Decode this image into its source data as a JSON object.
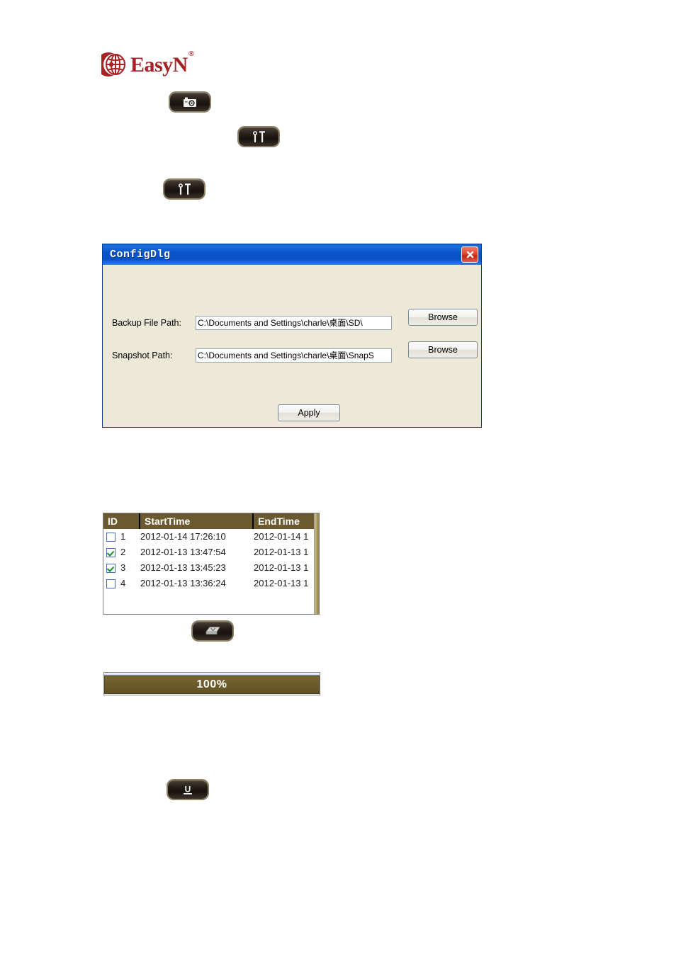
{
  "page": {
    "background": "#ffffff",
    "brand_color": "#a52225"
  },
  "logo": {
    "word": "EasyN",
    "registered_mark": "®",
    "icon": "globe-icon"
  },
  "toolbar_buttons": [
    {
      "name": "snapshot-button",
      "icon": "camera-icon",
      "label": ""
    },
    {
      "name": "tools-button-1",
      "icon": "tools-icon",
      "label": ""
    },
    {
      "name": "tools-button-2",
      "icon": "tools-icon",
      "label": ""
    },
    {
      "name": "backup-button",
      "icon": "floppy-disk-icon",
      "label": ""
    },
    {
      "name": "update-button",
      "icon": "letter-u-icon",
      "label": "U"
    }
  ],
  "dialog": {
    "title": "ConfigDlg",
    "close_icon": "close-icon",
    "titlebar_color": "#0b51c6",
    "body_color": "#ece9d8",
    "fields": [
      {
        "label": "Backup File Path:",
        "value": "C:\\Documents and Settings\\charle\\桌面\\SD\\",
        "placeholder": "",
        "browse_label": "Browse"
      },
      {
        "label": "Snapshot Path:",
        "value": "C:\\Documents and Settings\\charle\\桌面\\SnapS",
        "placeholder": "",
        "browse_label": "Browse"
      }
    ],
    "apply_label": "Apply"
  },
  "record_table": {
    "header_color": "#6b5a2f",
    "columns": [
      "ID",
      "StartTime",
      "EndTime"
    ],
    "rows": [
      {
        "checked": false,
        "id": "1",
        "start": "2012-01-14 17:26:10",
        "end": "2012-01-14 1"
      },
      {
        "checked": true,
        "id": "2",
        "start": "2012-01-13 13:47:54",
        "end": "2012-01-13 1"
      },
      {
        "checked": true,
        "id": "3",
        "start": "2012-01-13 13:45:23",
        "end": "2012-01-13 1"
      },
      {
        "checked": false,
        "id": "4",
        "start": "2012-01-13 13:36:24",
        "end": "2012-01-13 1"
      }
    ]
  },
  "progress": {
    "value": 100,
    "text": "100%",
    "fill_color": "#6b5b2b"
  }
}
